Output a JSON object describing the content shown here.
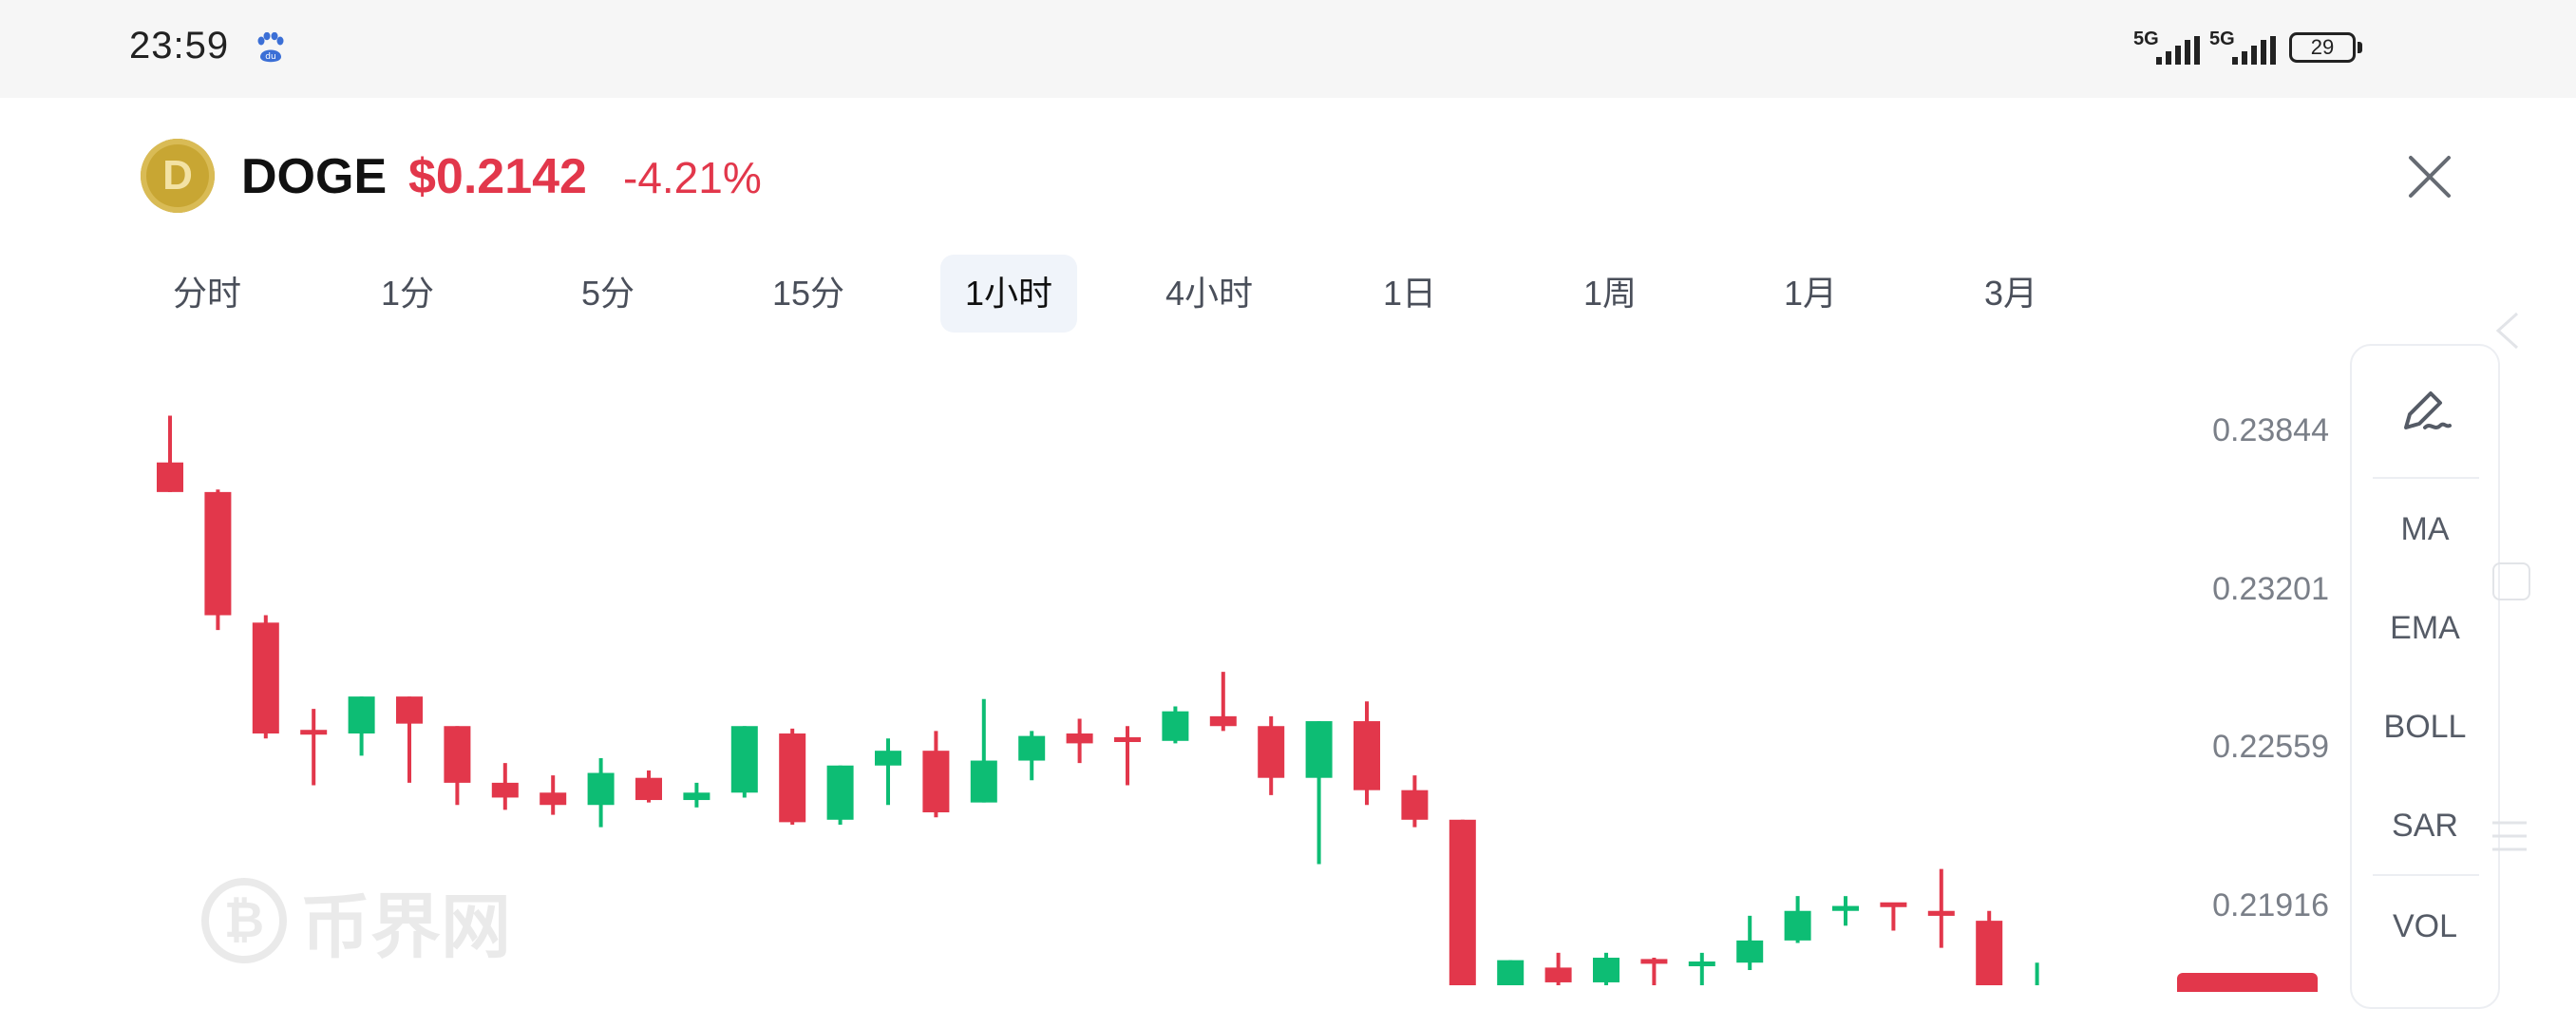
{
  "status_bar": {
    "time": "23:59",
    "baidu_icon": "baidu-paw-icon",
    "signals": [
      {
        "label": "5G",
        "level": 4
      },
      {
        "label": "5G",
        "level": 4
      }
    ],
    "battery": "29"
  },
  "header": {
    "coin_icon": "doge-coin-icon",
    "coin_glyph": "D",
    "symbol": "DOGE",
    "price": "$0.2142",
    "change": "-4.21%",
    "close_icon": "close-icon"
  },
  "tabs": [
    {
      "label": "分时",
      "active": false
    },
    {
      "label": "1分",
      "active": false
    },
    {
      "label": "5分",
      "active": false
    },
    {
      "label": "15分",
      "active": false
    },
    {
      "label": "1小时",
      "active": true
    },
    {
      "label": "4小时",
      "active": false
    },
    {
      "label": "1日",
      "active": false
    },
    {
      "label": "1周",
      "active": false
    },
    {
      "label": "1月",
      "active": false
    },
    {
      "label": "3月",
      "active": false
    }
  ],
  "indicator_panel": {
    "draw_icon": "pen-draw-icon",
    "items": [
      "MA",
      "EMA",
      "BOLL",
      "SAR",
      "VOL"
    ]
  },
  "watermark": {
    "glyph": "₿",
    "text": "币界网"
  },
  "colors": {
    "up": "#0dbd74",
    "down": "#e2374b",
    "accent": "#e2374b",
    "grid_text": "#7a7f88"
  },
  "chart_data": {
    "type": "candlestick",
    "y_axis_ticks": [
      "0.23844",
      "0.23201",
      "0.22559",
      "0.21916"
    ],
    "ylim": [
      0.2142,
      0.2403
    ],
    "candles": [
      {
        "o": 0.2371,
        "h": 0.239,
        "l": 0.236,
        "c": 0.2359
      },
      {
        "o": 0.2359,
        "h": 0.236,
        "l": 0.2303,
        "c": 0.2309
      },
      {
        "o": 0.2306,
        "h": 0.2309,
        "l": 0.2259,
        "c": 0.2261
      },
      {
        "o": 0.2262,
        "h": 0.2271,
        "l": 0.224,
        "c": 0.2261
      },
      {
        "o": 0.2261,
        "h": 0.2273,
        "l": 0.2252,
        "c": 0.2276
      },
      {
        "o": 0.2276,
        "h": 0.2276,
        "l": 0.2241,
        "c": 0.2265
      },
      {
        "o": 0.2264,
        "h": 0.2264,
        "l": 0.2232,
        "c": 0.2241
      },
      {
        "o": 0.2241,
        "h": 0.2249,
        "l": 0.223,
        "c": 0.2235
      },
      {
        "o": 0.2237,
        "h": 0.2244,
        "l": 0.2228,
        "c": 0.2232
      },
      {
        "o": 0.2232,
        "h": 0.2251,
        "l": 0.2223,
        "c": 0.2245
      },
      {
        "o": 0.2243,
        "h": 0.2246,
        "l": 0.2233,
        "c": 0.2234
      },
      {
        "o": 0.2234,
        "h": 0.2241,
        "l": 0.2231,
        "c": 0.2237
      },
      {
        "o": 0.2237,
        "h": 0.2262,
        "l": 0.2235,
        "c": 0.2264
      },
      {
        "o": 0.2261,
        "h": 0.2263,
        "l": 0.2224,
        "c": 0.2225
      },
      {
        "o": 0.2226,
        "h": 0.2247,
        "l": 0.2224,
        "c": 0.2248
      },
      {
        "o": 0.2248,
        "h": 0.2259,
        "l": 0.2232,
        "c": 0.2254
      },
      {
        "o": 0.2254,
        "h": 0.2262,
        "l": 0.2227,
        "c": 0.2229
      },
      {
        "o": 0.2233,
        "h": 0.2275,
        "l": 0.2233,
        "c": 0.225
      },
      {
        "o": 0.225,
        "h": 0.2262,
        "l": 0.2242,
        "c": 0.226
      },
      {
        "o": 0.2261,
        "h": 0.2267,
        "l": 0.2249,
        "c": 0.2257
      },
      {
        "o": 0.2259,
        "h": 0.2264,
        "l": 0.224,
        "c": 0.2258
      },
      {
        "o": 0.2258,
        "h": 0.2272,
        "l": 0.2257,
        "c": 0.227
      },
      {
        "o": 0.2268,
        "h": 0.2286,
        "l": 0.2262,
        "c": 0.2264
      },
      {
        "o": 0.2264,
        "h": 0.2268,
        "l": 0.2236,
        "c": 0.2243
      },
      {
        "o": 0.2243,
        "h": 0.2266,
        "l": 0.2208,
        "c": 0.2266
      },
      {
        "o": 0.2266,
        "h": 0.2274,
        "l": 0.2232,
        "c": 0.2238
      },
      {
        "o": 0.2238,
        "h": 0.2244,
        "l": 0.2223,
        "c": 0.2226
      },
      {
        "o": 0.2226,
        "h": 0.2226,
        "l": 0.2147,
        "c": 0.2155
      },
      {
        "o": 0.2154,
        "h": 0.2169,
        "l": 0.2141,
        "c": 0.2169
      },
      {
        "o": 0.2166,
        "h": 0.2172,
        "l": 0.2157,
        "c": 0.216
      },
      {
        "o": 0.216,
        "h": 0.2172,
        "l": 0.2156,
        "c": 0.217
      },
      {
        "o": 0.2169,
        "h": 0.217,
        "l": 0.2151,
        "c": 0.2168
      },
      {
        "o": 0.2167,
        "h": 0.2172,
        "l": 0.2153,
        "c": 0.2168
      },
      {
        "o": 0.2168,
        "h": 0.2187,
        "l": 0.2165,
        "c": 0.2177
      },
      {
        "o": 0.2177,
        "h": 0.2195,
        "l": 0.2176,
        "c": 0.2189
      },
      {
        "o": 0.2189,
        "h": 0.2195,
        "l": 0.2183,
        "c": 0.2191
      },
      {
        "o": 0.2192,
        "h": 0.2191,
        "l": 0.2181,
        "c": 0.2191
      },
      {
        "o": 0.2189,
        "h": 0.2206,
        "l": 0.2174,
        "c": 0.2187
      },
      {
        "o": 0.2185,
        "h": 0.2189,
        "l": 0.2142,
        "c": 0.2142
      },
      {
        "o": 0.2142,
        "h": 0.2168,
        "l": 0.2142,
        "c": 0.2142
      }
    ]
  }
}
